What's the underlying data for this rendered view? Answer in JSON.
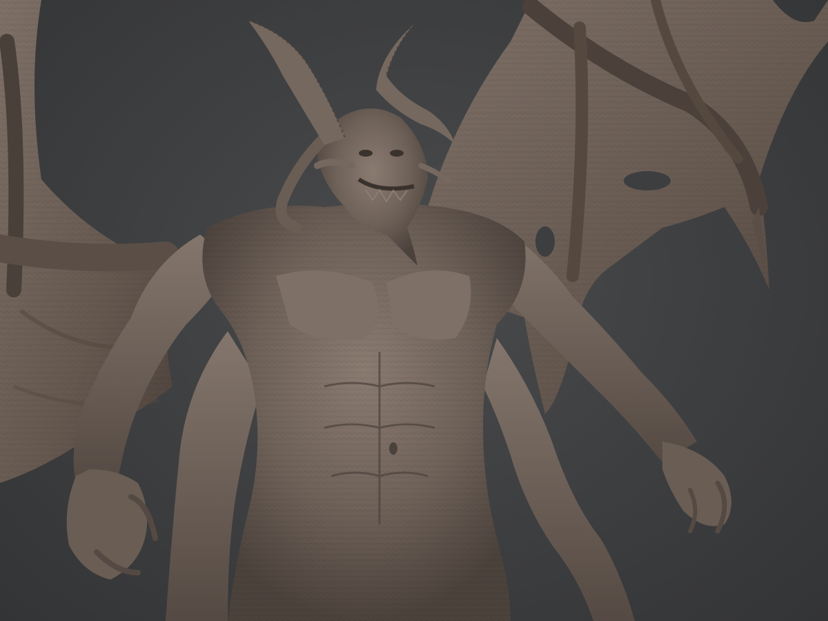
{
  "scene": {
    "subject": "winged-horned-demon-sculpt",
    "colors": {
      "background": "#3d3e40",
      "clay_light": "#8a7b71",
      "clay_mid": "#6f6259",
      "clay_dark": "#4c423c",
      "clay_shadow": "#3a322d"
    }
  }
}
